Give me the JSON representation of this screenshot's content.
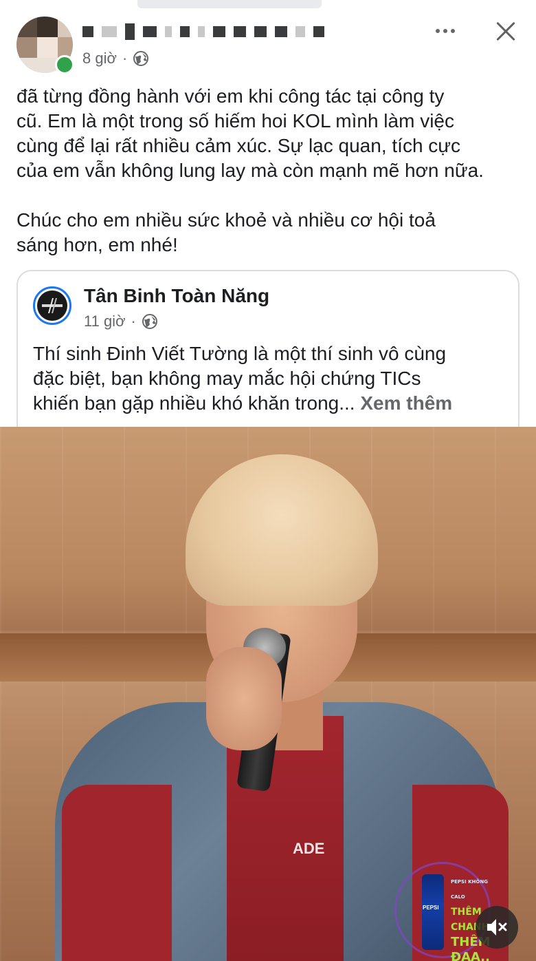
{
  "post": {
    "time": "8 giờ",
    "separator": "·",
    "privacy_icon": "globe-icon",
    "body_lines": [
      "đã từng đồng hành với em khi công tác tại công ty",
      "cũ. Em là một trong số hiếm hoi KOL mình làm việc",
      "cùng để lại rất nhiều cảm xúc. Sự lạc quan, tích cực",
      "của em vẫn không lung lay mà còn mạnh mẽ hơn nữa."
    ],
    "body_lines_2": [
      "Chúc cho em nhiều sức khoẻ và nhiều cơ hội toả",
      "sáng hơn, em nhé!"
    ]
  },
  "shared": {
    "page_name": "Tân Binh Toàn Năng",
    "time": "11 giờ",
    "separator": "·",
    "text_lines": [
      "Thí sinh Đinh Viết Tường là một thí sinh vô cùng",
      "đặc biệt, bạn không may mắc hội chứng TICs",
      "khiến bạn gặp nhiều khó khăn trong..."
    ],
    "see_more": "Xem thêm"
  },
  "video": {
    "badge_top": "PEPSI KHÔNG CALO",
    "badge_line1": "THÊM CHANH",
    "badge_line2": "THÊM ĐAA..",
    "can_label": "PEPSI",
    "shirt_text": "ADE"
  },
  "colors": {
    "accent": "#1877f2",
    "text": "#1c1e21",
    "muted": "#65676b",
    "online": "#31a24c"
  }
}
